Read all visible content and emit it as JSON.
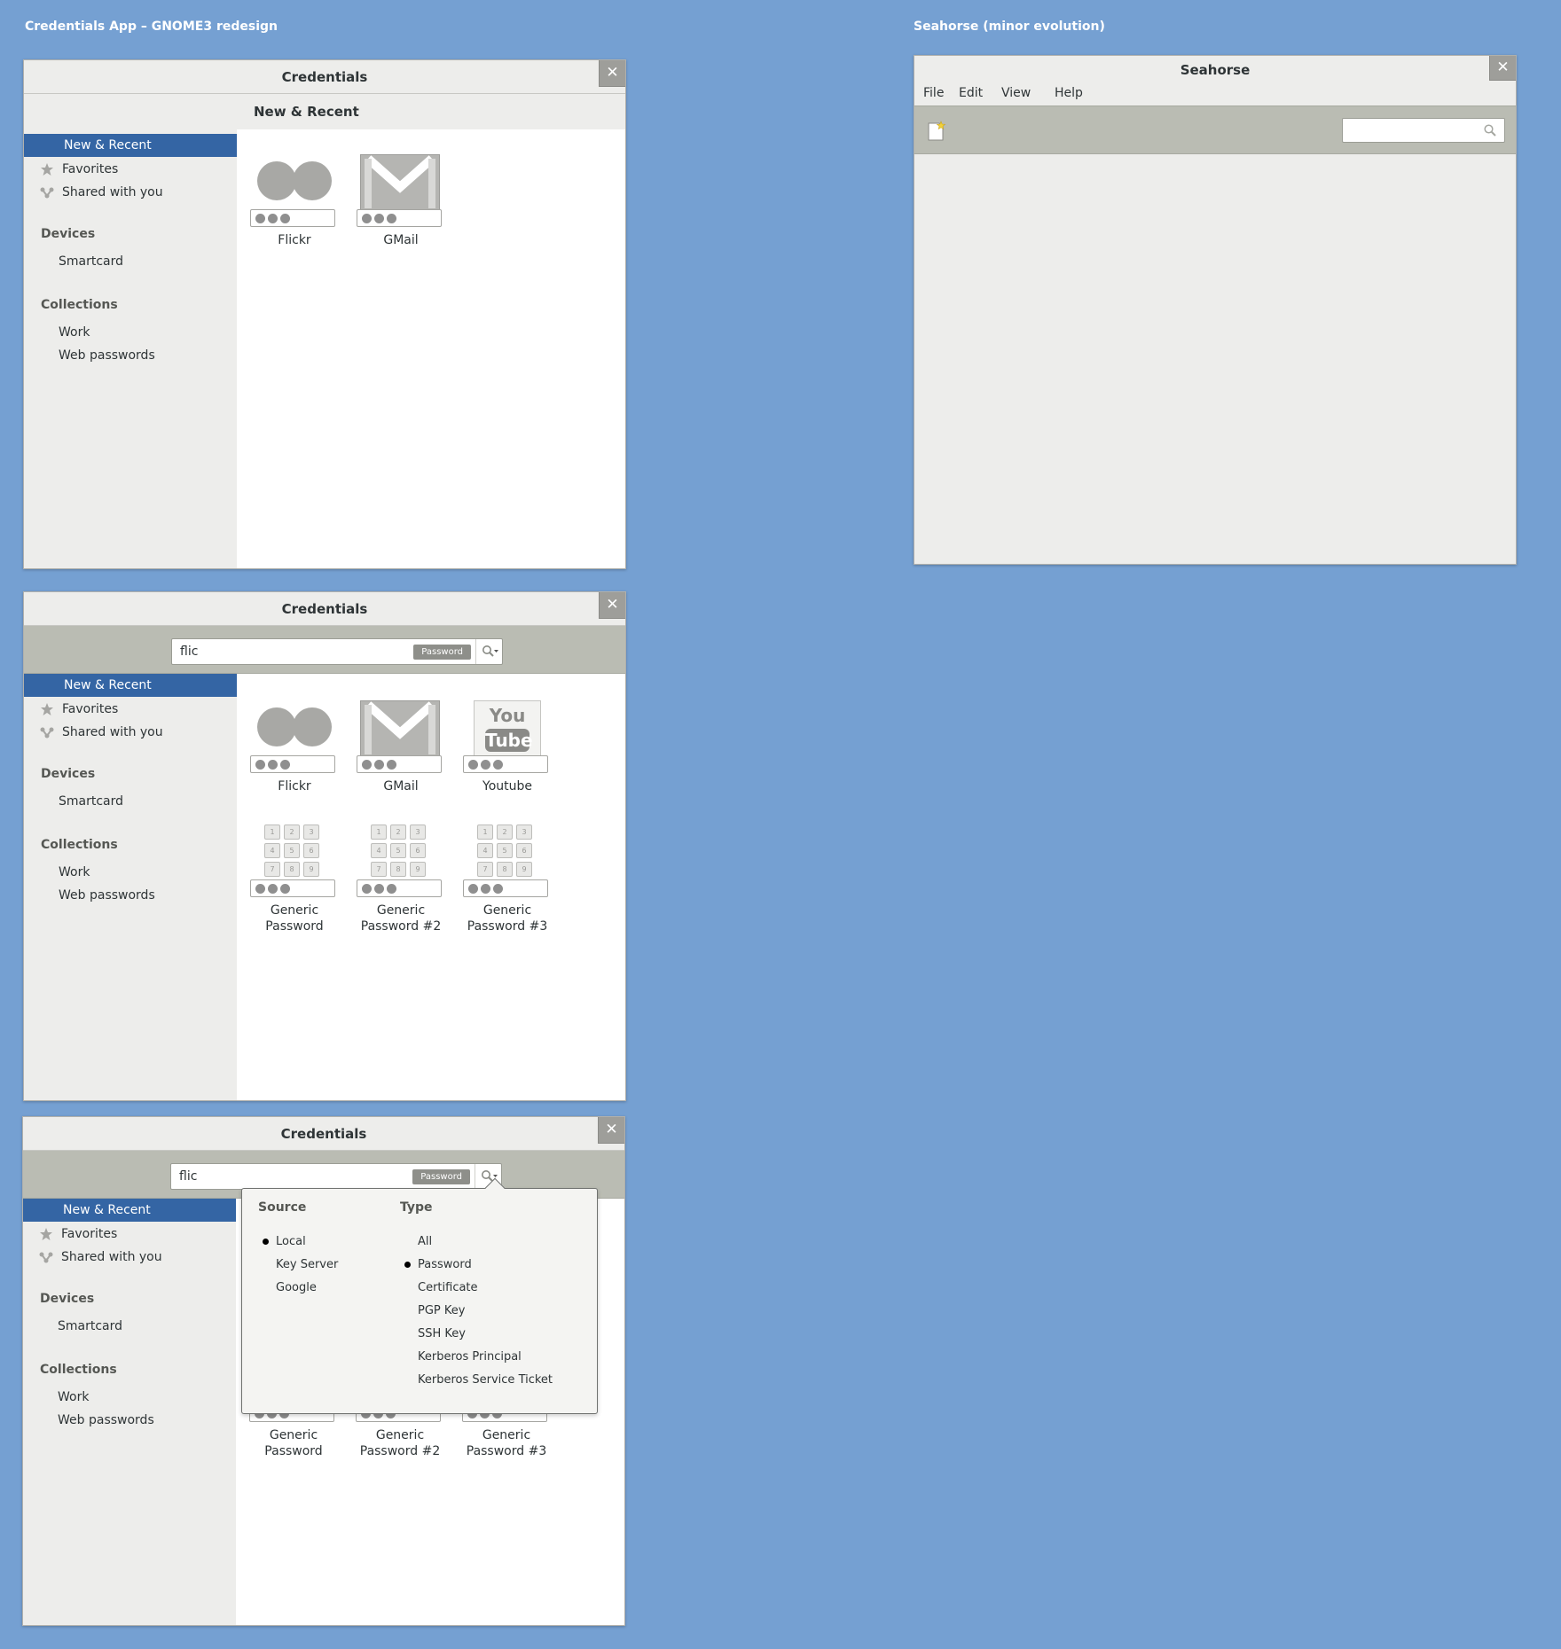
{
  "captions": {
    "left": "Credentials App – GNOME3 redesign",
    "right": "Seahorse (minor evolution)"
  },
  "window1": {
    "title": "Credentials",
    "close": "✕",
    "content_header": "New & Recent",
    "tiles": [
      {
        "name": "Flickr"
      },
      {
        "name": "GMail"
      }
    ]
  },
  "sidebar": {
    "items": [
      {
        "label": "New & Recent"
      },
      {
        "label": "Favorites"
      },
      {
        "label": "Shared with you"
      }
    ],
    "devices_heading": "Devices",
    "devices": [
      {
        "label": "Smartcard"
      }
    ],
    "collections_heading": "Collections",
    "collections": [
      {
        "label": "Work"
      },
      {
        "label": "Web passwords"
      }
    ]
  },
  "window2": {
    "title": "Credentials",
    "close": "✕",
    "search_value": "flic",
    "search_tag": "Password",
    "tiles": [
      {
        "name": "Flickr"
      },
      {
        "name": "GMail"
      },
      {
        "name": "Youtube"
      },
      {
        "name": "Generic Password"
      },
      {
        "name": "Generic Password #2"
      },
      {
        "name": "Generic Password #3"
      }
    ],
    "youtube_logo": [
      "You",
      "Tube"
    ]
  },
  "window3": {
    "title": "Credentials",
    "close": "✕",
    "search_value": "flic",
    "search_tag": "Password",
    "tiles": [
      {
        "name": "Generic Password"
      },
      {
        "name": "Generic Password #2"
      },
      {
        "name": "Generic Password #3"
      }
    ],
    "popover": {
      "source_heading": "Source",
      "source_items": [
        "Local",
        "Key Server",
        "Google"
      ],
      "source_selected": "Local",
      "type_heading": "Type",
      "type_items": [
        "All",
        "Password",
        "Certificate",
        "PGP Key",
        "SSH Key",
        "Kerberos Principal",
        "Kerberos Service Ticket"
      ],
      "type_selected": "Password"
    }
  },
  "keypad_digits": [
    "1",
    "2",
    "3",
    "4",
    "5",
    "6",
    "7",
    "8",
    "9"
  ],
  "seahorse": {
    "title": "Seahorse",
    "close": "✕",
    "menus": [
      "File",
      "Edit",
      "View",
      "Help"
    ],
    "search_value": ""
  },
  "colors": {
    "background": "#75a0d2",
    "accent": "#3465a4",
    "toolbar": "#babcb3"
  }
}
